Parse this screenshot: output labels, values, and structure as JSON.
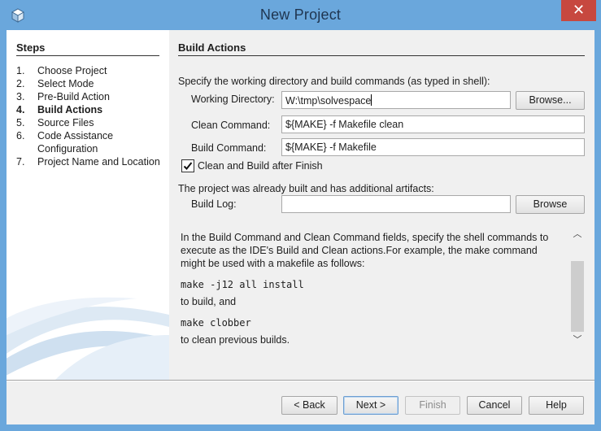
{
  "window": {
    "title": "New Project",
    "close_glyph": "✕"
  },
  "steps": {
    "heading": "Steps",
    "items": [
      {
        "num": "1.",
        "label": "Choose Project",
        "active": false
      },
      {
        "num": "2.",
        "label": "Select Mode",
        "active": false
      },
      {
        "num": "3.",
        "label": "Pre-Build Action",
        "active": false
      },
      {
        "num": "4.",
        "label": "Build Actions",
        "active": true
      },
      {
        "num": "5.",
        "label": "Source Files",
        "active": false
      },
      {
        "num": "6.",
        "label": "Code Assistance Configuration",
        "active": false
      },
      {
        "num": "7.",
        "label": "Project Name and Location",
        "active": false
      }
    ]
  },
  "main": {
    "title": "Build Actions",
    "intro": "Specify the working directory and build commands (as typed in shell):",
    "working_dir_label": "Working Directory:",
    "working_dir_value": "W:\\tmp\\solvespace",
    "browse_label": "Browse...",
    "clean_label": "Clean Command:",
    "clean_value": "${MAKE} -f Makefile clean",
    "build_label": "Build Command:",
    "build_value": "${MAKE} -f Makefile",
    "clean_build_checkbox_label": "Clean and Build after Finish",
    "clean_build_checked": true,
    "artifacts_text": "The project was already built and has additional artifacts:",
    "build_log_label": "Build Log:",
    "build_log_value": "",
    "build_log_browse_label": "Browse"
  },
  "help": {
    "paragraph": "In the Build Command and Clean Command fields, specify the shell commands to execute as the IDE's Build and Clean actions.For example, the make command might be used with a makefile as follows:",
    "cmd1": "make -j12 all install",
    "text1": "to build, and",
    "cmd2": "make clobber",
    "text2": "to clean previous builds.",
    "scroll_up_glyph": "︿",
    "scroll_down_glyph": "﹀"
  },
  "footer": {
    "back": "< Back",
    "next": "Next >",
    "finish": "Finish",
    "cancel": "Cancel",
    "help": "Help"
  },
  "icons": {
    "app": "netbeans-cube-icon",
    "check": "check-icon"
  },
  "colors": {
    "titlebar": "#6aa7dc",
    "close": "#c7483f",
    "dialog_bg": "#f0f0f0"
  }
}
